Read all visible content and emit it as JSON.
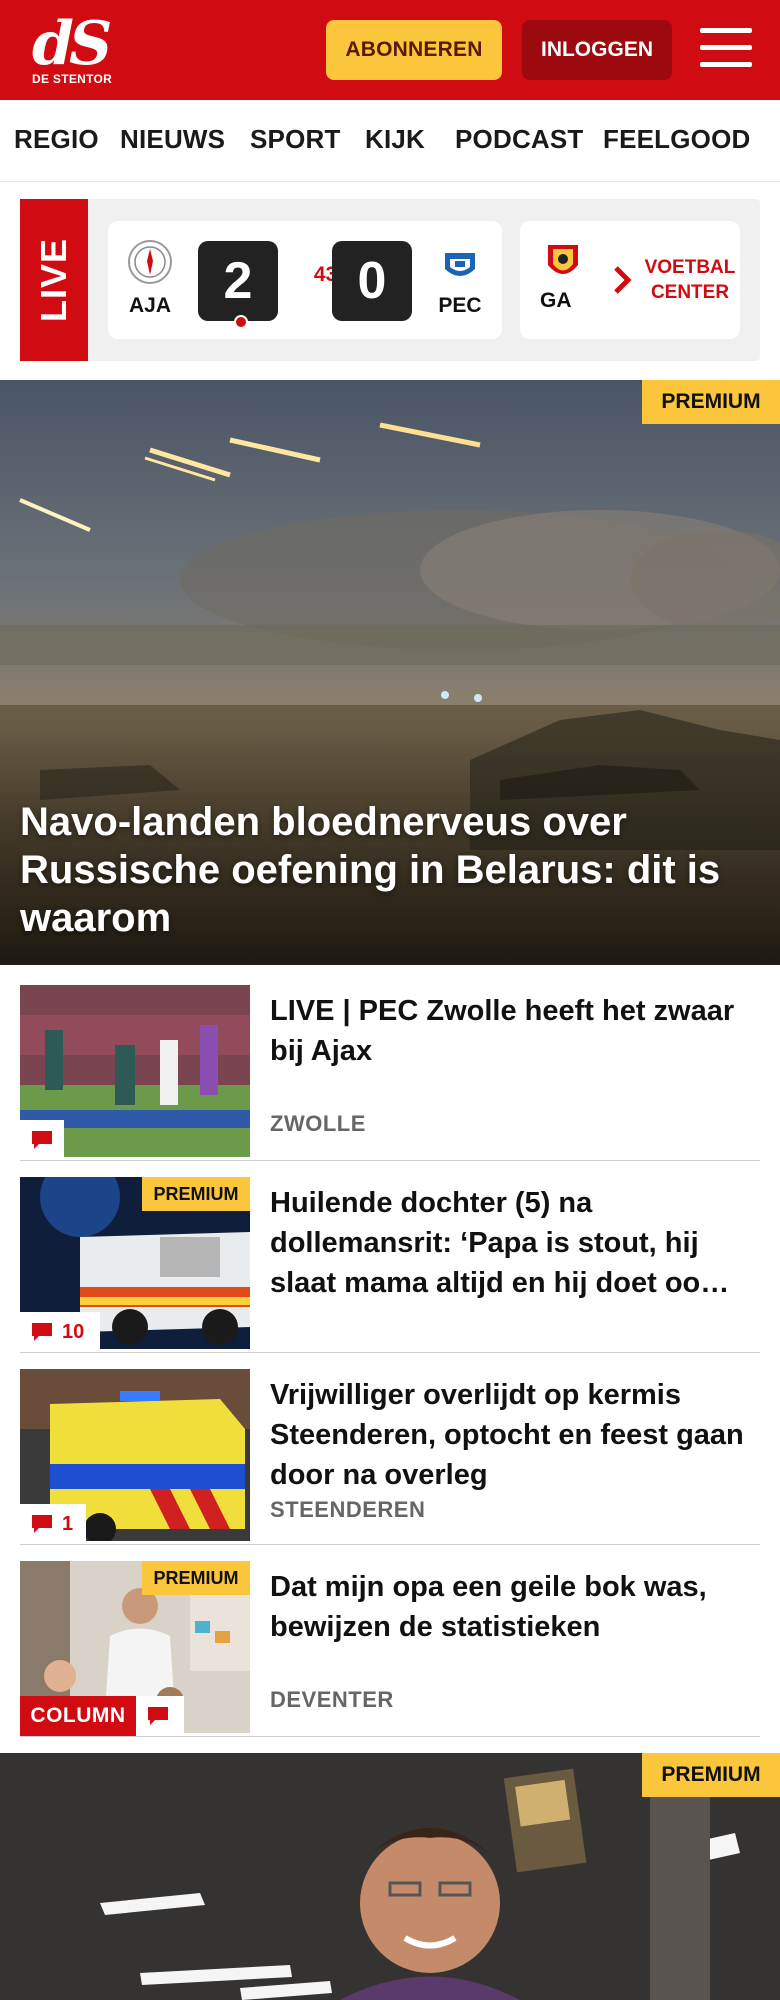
{
  "header": {
    "logo_mark": "dS",
    "logo_sub": "DE STENTOR",
    "subscribe_label": "ABONNEREN",
    "login_label": "INLOGGEN",
    "menu_icon": "hamburger-menu-icon",
    "brand_color": "#d00b11",
    "accent_color": "#fbc53c"
  },
  "nav": {
    "items": [
      "REGIO",
      "NIEUWS",
      "SPORT",
      "KIJK",
      "PODCAST",
      "FEELGOOD"
    ]
  },
  "live_bar": {
    "tag": "LIVE",
    "match": {
      "home_abbr": "AJA",
      "home_score": "2",
      "minute": "43'",
      "away_score": "0",
      "away_abbr": "PEC",
      "away_crest_text": "PEC ZWOLLE"
    },
    "next_match_abbr": "GA",
    "voetbal_center_label": "VOETBAL CENTER"
  },
  "hero": {
    "badge": "PREMIUM",
    "title": "Navo-landen bloednerveus over Russische oefening in Belarus: dit is waarom"
  },
  "articles": [
    {
      "title": "LIVE | PEC Zwolle heeft het zwaar bij Ajax",
      "location": "ZWOLLE",
      "comment_count": "",
      "premium": false
    },
    {
      "badge": "PREMIUM",
      "title": "Huilende dochter (5) na dollemansrit: ‘Papa is stout, hij slaat mama altijd en hij doet oo…",
      "location": "",
      "comment_count": "10",
      "premium": true
    },
    {
      "title": "Vrijwilliger overlijdt op kermis Steenderen, optocht en feest gaan door na overleg",
      "location": "STEENDEREN",
      "comment_count": "1",
      "premium": false
    },
    {
      "badge": "PREMIUM",
      "title": "Dat mijn opa een geile bok was, bewijzen de statistieken",
      "location": "DEVENTER",
      "column_label": "COLUMN",
      "comment_count": "",
      "premium": true
    }
  ],
  "hero2": {
    "badge": "PREMIUM"
  }
}
